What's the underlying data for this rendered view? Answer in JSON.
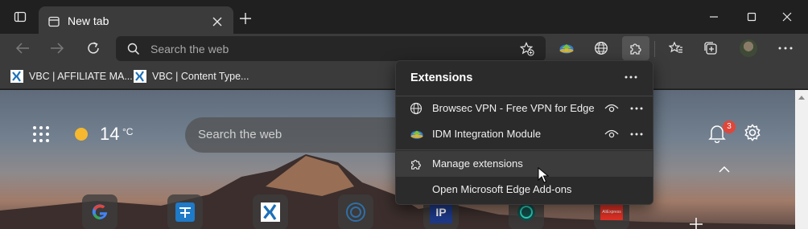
{
  "tab": {
    "title": "New tab"
  },
  "toolbar": {
    "search_placeholder": "Search the web"
  },
  "favorites": [
    {
      "label": "VBC | AFFILIATE MA..."
    },
    {
      "label": "VBC | Content Type..."
    }
  ],
  "weather": {
    "temperature": "14",
    "unit": "°C"
  },
  "ntp": {
    "search_placeholder": "Search the web",
    "notification_count": "3"
  },
  "tiles": [
    {
      "icon": "google-icon"
    },
    {
      "icon": "translate-icon"
    },
    {
      "icon": "vbc-logo-icon"
    },
    {
      "icon": "circle-logo-icon"
    },
    {
      "label": "IP"
    },
    {
      "icon": "shield-logo-icon"
    },
    {
      "label": "AliExpress"
    }
  ],
  "extensions_panel": {
    "title": "Extensions",
    "items": [
      {
        "label": "Browsec VPN - Free VPN for Edge",
        "icon": "globe-icon"
      },
      {
        "label": "IDM Integration Module",
        "icon": "idm-icon"
      }
    ],
    "manage_label": "Manage extensions",
    "addons_label": "Open Microsoft Edge Add-ons"
  },
  "colors": {
    "accent_badge": "#e0463a",
    "panel_bg": "#2b2b2b",
    "toolbar_bg": "#3b3b3b"
  }
}
